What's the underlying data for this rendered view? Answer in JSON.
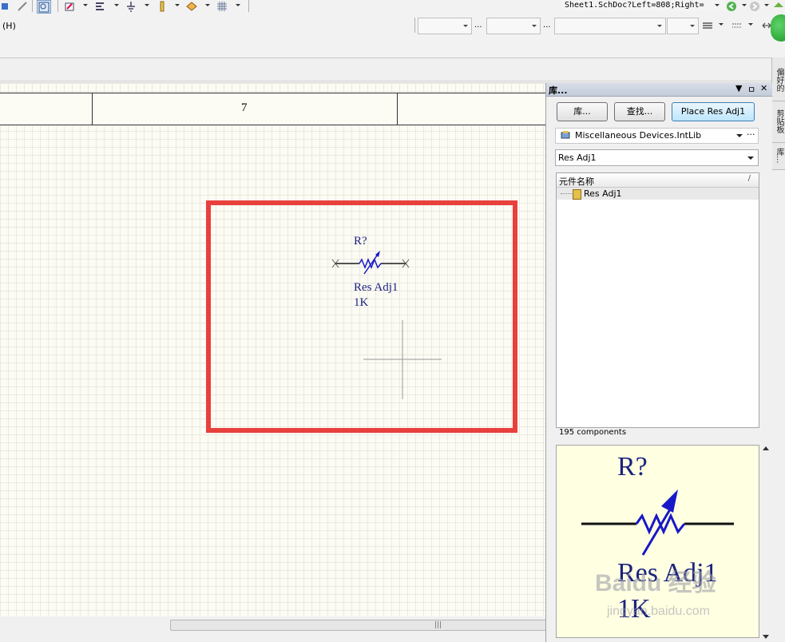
{
  "toolbar": {
    "address": "Sheet1.SchDoc?Left=808;Right=",
    "menu_partial": "(H)",
    "combo_separator": "..."
  },
  "right_tabs": [
    "偏好的",
    "剪贴板",
    "库..."
  ],
  "sheet": {
    "zone_label": "7",
    "component": {
      "designator": "R?",
      "comment": "Res Adj1",
      "value": "1K"
    }
  },
  "panel": {
    "title": "库...",
    "title_controls": [
      "▼",
      "ㅁ",
      "✕"
    ],
    "buttons": {
      "libraries": "库...",
      "search": "查找...",
      "place": "Place Res Adj1"
    },
    "library_name": "Miscellaneous Devices.IntLib",
    "library_more": "···",
    "filter_value": "Res Adj1",
    "list": {
      "column_header": "元件名称",
      "sort_glyph": "/",
      "rows": [
        "Res Adj1"
      ]
    },
    "component_count": "195 components",
    "preview": {
      "designator": "R?",
      "comment": "Res Adj1",
      "value": "1K"
    }
  },
  "watermark": {
    "brand": "Baidu 经验",
    "url": "jingyan.baidu.com"
  },
  "colors": {
    "highlight_box": "#e8403d",
    "component_blue": "#1818c8",
    "text_navy": "#1a237e",
    "sheet_bg": "#fcfbf4",
    "preview_bg": "#ffffe2"
  }
}
